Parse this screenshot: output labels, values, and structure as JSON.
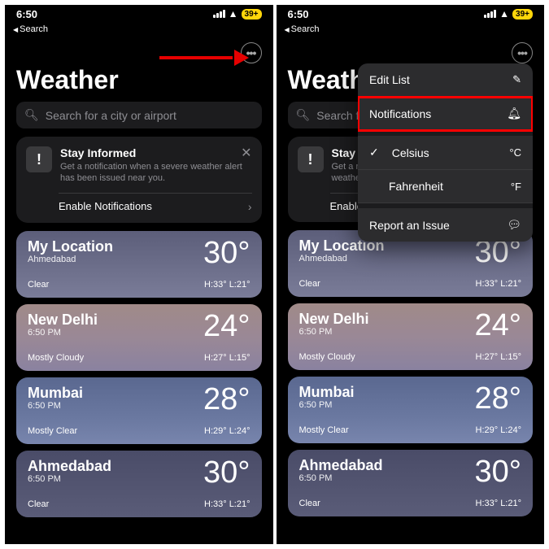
{
  "status": {
    "time": "6:50",
    "battery": "39+"
  },
  "back": "Search",
  "app_title": "Weather",
  "search_placeholder": "Search for a city or airport",
  "banner": {
    "title": "Stay Informed",
    "subtitle": "Get a notification when a severe weather alert has been issued near you.",
    "action": "Enable Notifications"
  },
  "cities": [
    {
      "name": "My Location",
      "sub": "Ahmedabad",
      "temp": "30°",
      "cond": "Clear",
      "hilo": "H:33° L:21°",
      "bg": "card-bg0"
    },
    {
      "name": "New Delhi",
      "sub": "6:50 PM",
      "temp": "24°",
      "cond": "Mostly Cloudy",
      "hilo": "H:27° L:15°",
      "bg": "card-bg1"
    },
    {
      "name": "Mumbai",
      "sub": "6:50 PM",
      "temp": "28°",
      "cond": "Mostly Clear",
      "hilo": "H:29° L:24°",
      "bg": "card-bg2"
    },
    {
      "name": "Ahmedabad",
      "sub": "6:50 PM",
      "temp": "30°",
      "cond": "Clear",
      "hilo": "H:33° L:21°",
      "bg": "card-bg3"
    }
  ],
  "menu": {
    "edit": "Edit List",
    "notifications": "Notifications",
    "celsius": "Celsius",
    "celsius_sym": "°C",
    "fahrenheit": "Fahrenheit",
    "fahrenheit_sym": "°F",
    "report": "Report an Issue"
  },
  "truncated": {
    "title": "Weathe",
    "banner_title": "Stay In",
    "sub1": "Get a no",
    "sub2": "weather",
    "action": "Enable"
  }
}
